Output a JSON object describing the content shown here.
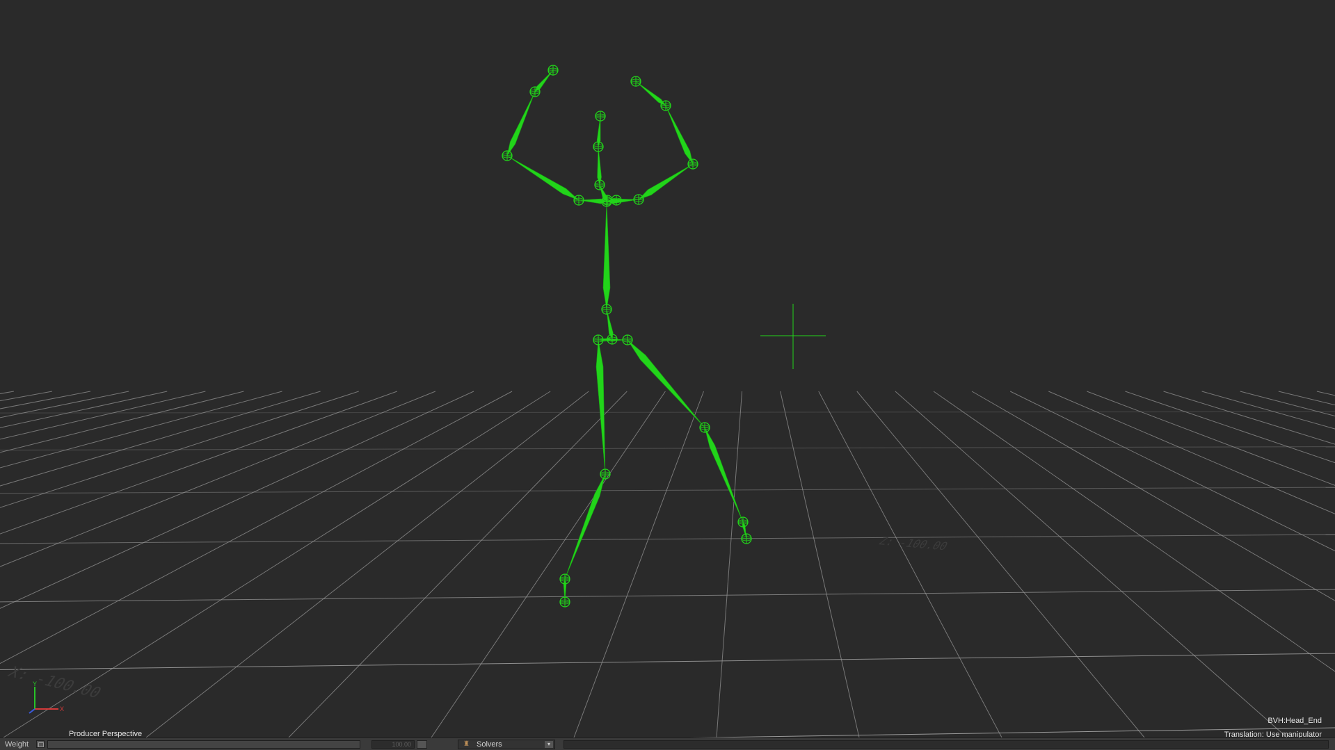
{
  "viewport": {
    "camera_label": "Producer Perspective",
    "selected_object": "BVH:Head_End",
    "tool_status": "Translation: Use manipulator",
    "grid_labels": [
      "X: -100.00",
      "Z: -100.00"
    ],
    "axis_gizmo": {
      "x_label": "X",
      "y_label": "Y"
    },
    "skeleton_color": "#22d41a",
    "grid_color": "#9a9a9a",
    "background_color": "#2a2a2a"
  },
  "bottom_bar": {
    "weight_label": "Weight",
    "weight_value": "100.00",
    "weight_fraction": 1.0,
    "solvers_label": "Solvers",
    "solvers_icon": "solver-icon",
    "dropdown_icon": "chevron-down-icon"
  }
}
